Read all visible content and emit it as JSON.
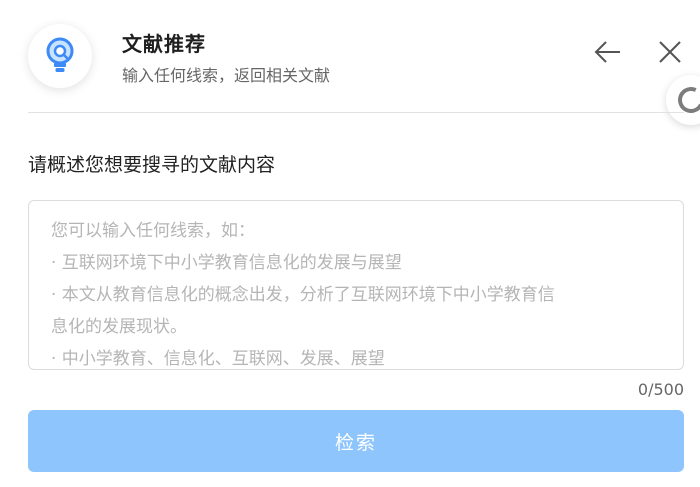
{
  "header": {
    "title": "文献推荐",
    "subtitle": "输入任何线索，返回相关文献",
    "logo_icon": "lightbulb-icon",
    "back_icon": "arrow-left-icon",
    "close_icon": "close-icon"
  },
  "form": {
    "label": "请概述您想要搜寻的文献内容",
    "placeholder_lines": [
      "您可以输入任何线索，如：",
      "·  互联网环境下中小学教育信息化的发展与展望",
      "·  本文从教育信息化的概念出发，分析了互联网环境下中小学教育信",
      "息化的发展现状。",
      "·  中小学教育、信息化、互联网、发展、展望"
    ],
    "counter": "0/500",
    "submit_label": "检索"
  },
  "colors": {
    "accent": "#3d8af7",
    "button_disabled": "#8ec5fc"
  }
}
